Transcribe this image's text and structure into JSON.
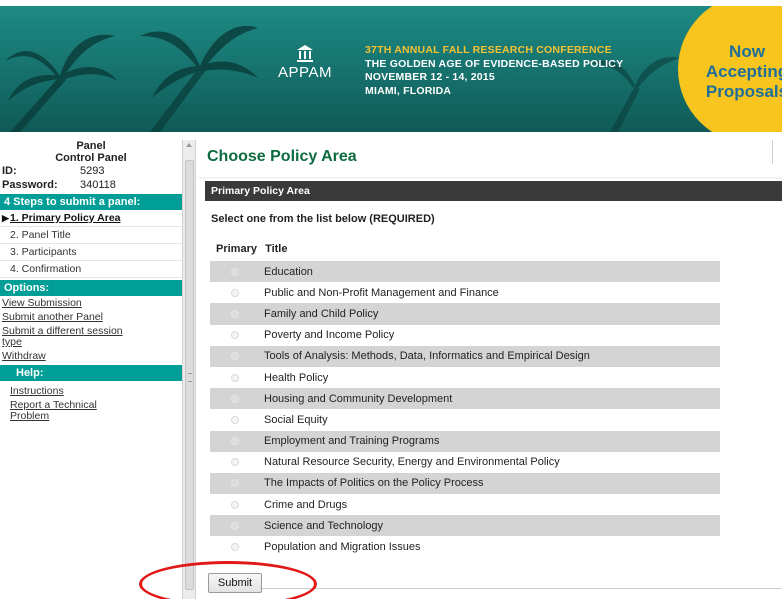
{
  "banner": {
    "logo_text": "APPAM",
    "conference_line1": "37TH ANNUAL FALL RESEARCH CONFERENCE",
    "conference_line2": "THE GOLDEN AGE OF EVIDENCE-BASED POLICY",
    "conference_line3": "NOVEMBER 12 - 14, 2015",
    "conference_line4": "MIAMI, FLORIDA",
    "badge_line1": "Now",
    "badge_line2": "Accepting",
    "badge_line3": "Proposals",
    "colors": {
      "teal": "#16706c",
      "gold_text": "#f3c233",
      "badge": "#f7c51e",
      "badge_text": "#1f6f9a"
    }
  },
  "sidebar": {
    "heading_line1": "Panel",
    "heading_line2": "Control Panel",
    "id_label": "ID:",
    "id_value": "5293",
    "password_label": "Password:",
    "password_value": "340118",
    "steps_header": "4 Steps to submit a panel:",
    "steps": [
      {
        "label": "1. Primary Policy Area"
      },
      {
        "label": "2. Panel Title"
      },
      {
        "label": "3. Participants"
      },
      {
        "label": "4. Confirmation"
      }
    ],
    "options_header": "Options:",
    "options": [
      {
        "label": "View Submission"
      },
      {
        "label": "Submit another Panel"
      },
      {
        "label": "Submit a different session type"
      },
      {
        "label": "Withdraw"
      }
    ],
    "help_header": "Help:",
    "help_links": [
      {
        "label": "Instructions"
      },
      {
        "label": "Report a Technical Problem"
      }
    ],
    "accent_color": "#009e96"
  },
  "main": {
    "title": "Choose Policy Area",
    "section_header": "Primary Policy Area",
    "instruction": "Select one from the list below (REQUIRED)",
    "col_primary": "Primary",
    "col_title": "Title",
    "options": [
      {
        "title": "Education"
      },
      {
        "title": "Public and Non-Profit Management and Finance"
      },
      {
        "title": "Family and Child Policy"
      },
      {
        "title": "Poverty and Income Policy"
      },
      {
        "title": "Tools of Analysis: Methods, Data, Informatics and Empirical Design"
      },
      {
        "title": "Health Policy"
      },
      {
        "title": "Housing and Community Development"
      },
      {
        "title": "Social Equity"
      },
      {
        "title": "Employment and Training Programs"
      },
      {
        "title": "Natural Resource Security, Energy and Environmental Policy"
      },
      {
        "title": "The Impacts of Politics on the Policy Process"
      },
      {
        "title": "Crime and Drugs"
      },
      {
        "title": "Science and Technology"
      },
      {
        "title": "Population and Migration Issues"
      }
    ],
    "submit_label": "Submit",
    "title_color": "#0d6b3f",
    "highlight_color": "#e01818"
  }
}
